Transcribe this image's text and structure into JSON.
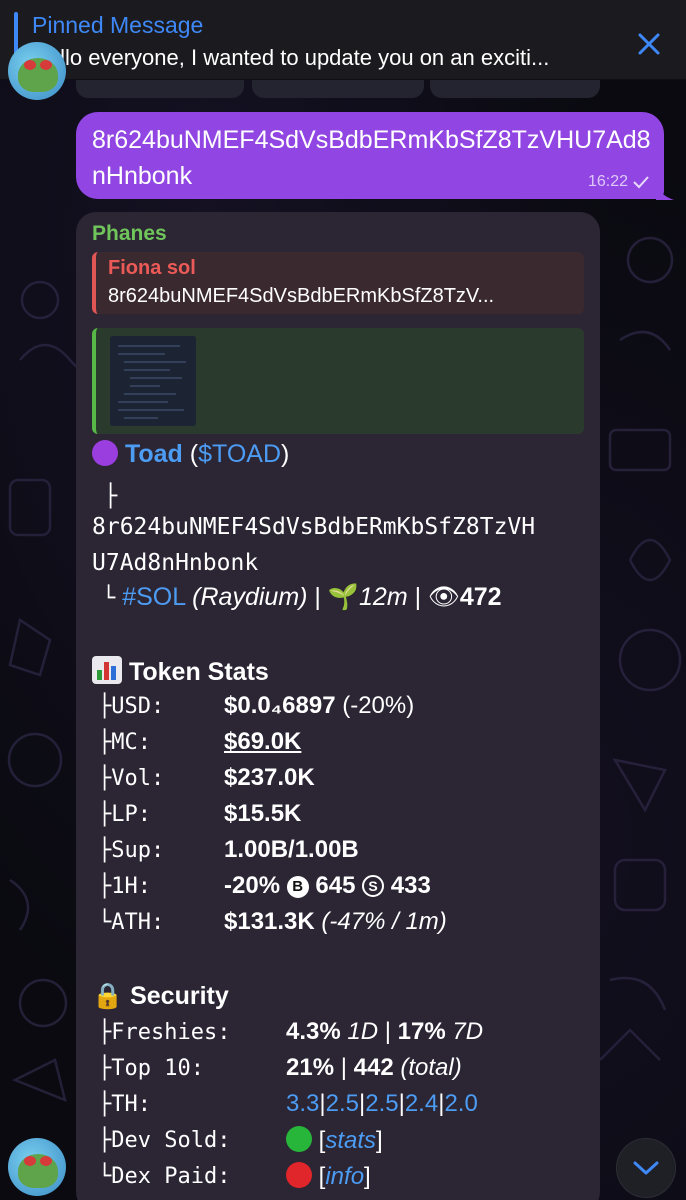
{
  "pinned": {
    "title": "Pinned Message",
    "text": "Hello everyone, I wanted to update you on an exciti..."
  },
  "outgoing": {
    "text": "8r624buNMEF4SdVsBdbERmKbSfZ8TzVHU7Ad8nHnbonk",
    "time": "16:22",
    "status_icon": "check-icon"
  },
  "incoming": {
    "sender": "Phanes",
    "reply": {
      "name": "Fiona sol",
      "text": "8r624buNMEF4SdVsBdbERmKbSfZ8TzV..."
    },
    "token": {
      "name": "Toad",
      "ticker": "$TOAD",
      "tree1": "├",
      "address_line1": "8r624buNMEF4SdVsBdbERmKbSfZ8TzVH",
      "address_line2": "U7Ad8nHnbonk",
      "tree2": "└",
      "chain": "#SOL",
      "dex": "(Raydium)",
      "age": "12m",
      "views": "472"
    },
    "token_stats": {
      "heading": "Token Stats",
      "rows": [
        {
          "key": "├USD:",
          "value": "$0.0₄6897",
          "extra": "(-20%)"
        },
        {
          "key": "├MC:",
          "value": "$69.0K"
        },
        {
          "key": "├Vol:",
          "value": "$237.0K"
        },
        {
          "key": "├LP:",
          "value": "$15.5K"
        },
        {
          "key": "├Sup:",
          "value": "1.00B/1.00B"
        },
        {
          "key": "├1H:",
          "value": "-20%",
          "buys": "645",
          "sells": "433"
        },
        {
          "key": "└ATH:",
          "value": "$131.3K",
          "extra": "(-47% / 1m)"
        }
      ]
    },
    "security": {
      "heading": "Security",
      "rows": [
        {
          "key": "├Freshies:",
          "v1": "4.3%",
          "v1s": "1D",
          "sep": "|",
          "v2": "17%",
          "v2s": "7D"
        },
        {
          "key": "├Top 10:",
          "v1": "21%",
          "sep": "|",
          "v2": "442",
          "v2s": "(total)"
        },
        {
          "key": "├TH:",
          "holders": [
            "3.3",
            "2.5",
            "2.5",
            "2.4",
            "2.0"
          ]
        },
        {
          "key": "├Dev Sold:",
          "status_color": "#27b53a",
          "link": "stats"
        },
        {
          "key": "└Dex Paid:",
          "status_color": "#e0262a",
          "link": "info"
        }
      ]
    }
  },
  "colors": {
    "accent": "#3e88f7",
    "outgoing_bubble": "#9146e3",
    "incoming_bubble": "#2b2534",
    "sender": "#6fc55a",
    "reply_accent": "#e05655",
    "link": "#4d9cf3"
  }
}
